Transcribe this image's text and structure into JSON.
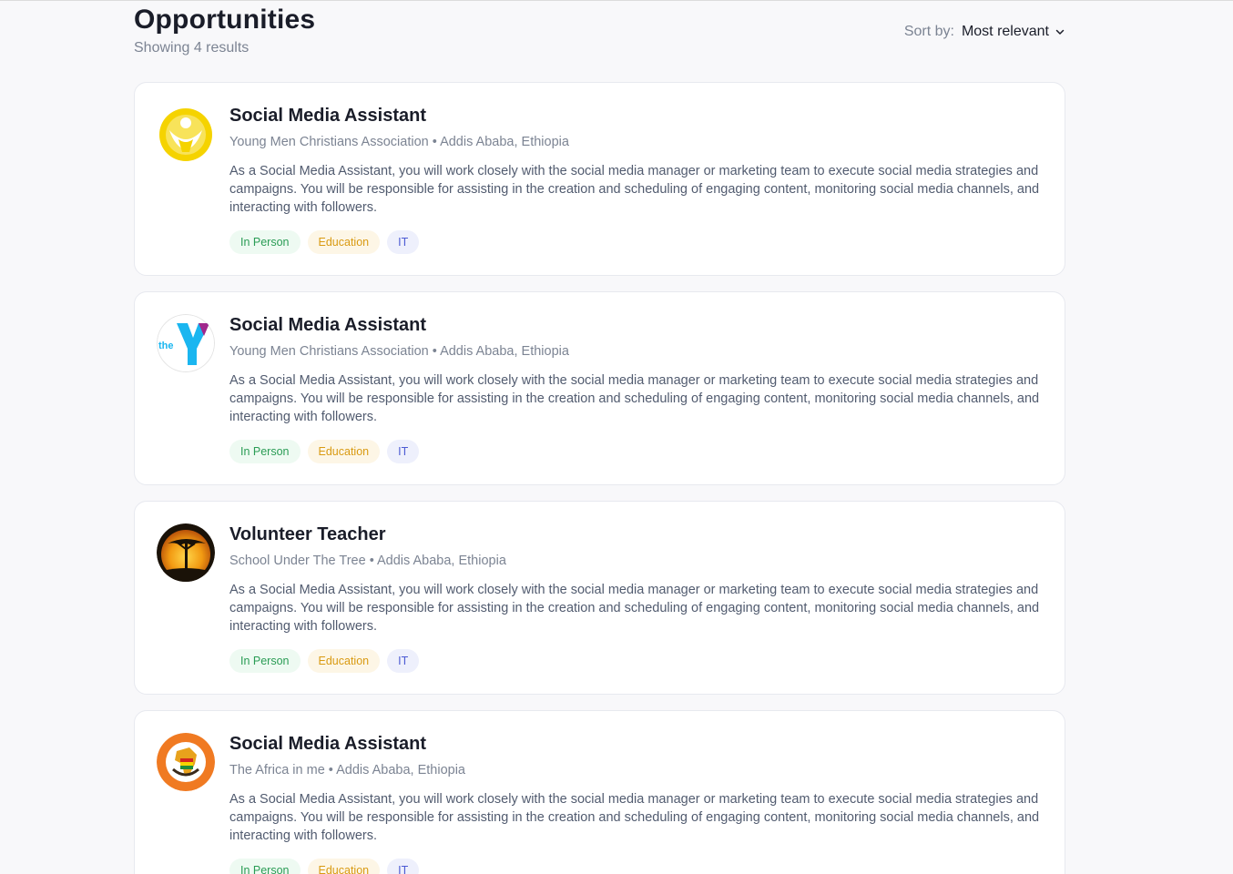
{
  "header": {
    "title": "Opportunities",
    "subtitle": "Showing 4 results",
    "sort_label": "Sort by:",
    "sort_value": "Most relevant"
  },
  "jobs": [
    {
      "title": "Social Media Assistant",
      "org": "Young Men Christians Association",
      "sep": "•",
      "location": "Addis Ababa, Ethiopia",
      "description": "As a Social Media Assistant, you will work closely with the social media manager or marketing team to execute social media strategies and campaigns. You will be responsible for assisting in the creation and scheduling of engaging content, monitoring social media channels, and interacting with followers.",
      "tags": [
        "In Person",
        "Education",
        "IT"
      ],
      "logo": "ymca-yellow-logo"
    },
    {
      "title": "Social Media Assistant",
      "org": "Young Men Christians Association",
      "sep": "•",
      "location": "Addis Ababa, Ethiopia",
      "description": "As a Social Media Assistant, you will work closely with the social media manager or marketing team to execute social media strategies and campaigns. You will be responsible for assisting in the creation and scheduling of engaging content, monitoring social media channels, and interacting with followers.",
      "tags": [
        "In Person",
        "Education",
        "IT"
      ],
      "logo": "the-y-logo",
      "logo_text": "the"
    },
    {
      "title": "Volunteer Teacher",
      "org": "School Under The Tree",
      "sep": "•",
      "location": "Addis Ababa, Ethiopia",
      "description": "As a Social Media Assistant, you will work closely with the social media manager or marketing team to execute social media strategies and campaigns. You will be responsible for assisting in the creation and scheduling of engaging content, monitoring social media channels, and interacting with followers.",
      "tags": [
        "In Person",
        "Education",
        "IT"
      ],
      "logo": "tree-sunset-logo"
    },
    {
      "title": "Social Media Assistant",
      "org": "The Africa in me",
      "sep": "•",
      "location": "Addis Ababa, Ethiopia",
      "description": "As a Social Media Assistant, you will work closely with the social media manager or marketing team to execute social media strategies and campaigns. You will be responsible for assisting in the creation and scheduling of engaging content, monitoring social media channels, and interacting with followers.",
      "tags": [
        "In Person",
        "Education",
        "IT"
      ],
      "logo": "africa-in-me-logo"
    }
  ],
  "colors": {
    "tag_green_text": "#2a9c55",
    "tag_yellow_text": "#d99a12",
    "tag_blue_text": "#4c5bd4",
    "ymca_yellow": "#f5d300",
    "ymca_blue": "#1ab6f0",
    "ymca_purple": "#a0288c",
    "sunset_orange": "#f29a12",
    "africa_orange": "#f07a22"
  }
}
